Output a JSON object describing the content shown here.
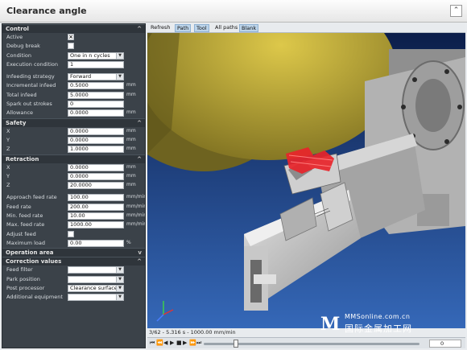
{
  "window": {
    "title": "Clearance angle",
    "collapse_icon": "chevron-up-icon"
  },
  "panel": {
    "control": {
      "header": "Control",
      "rows": [
        {
          "label": "Active",
          "type": "checkbox",
          "checked": true
        },
        {
          "label": "Debug break",
          "type": "checkbox",
          "checked": false
        },
        {
          "label": "Condition",
          "type": "select",
          "value": "One in n cycles"
        },
        {
          "label": "Execution condition",
          "type": "text",
          "value": "1"
        }
      ],
      "rows2": [
        {
          "label": "Infeeding strategy",
          "type": "select",
          "value": "Forward"
        },
        {
          "label": "Incremental infeed",
          "type": "text",
          "value": "0.5000",
          "unit": "mm"
        },
        {
          "label": "Total infeed",
          "type": "text",
          "value": "5.0000",
          "unit": "mm"
        },
        {
          "label": "Spark out strokes",
          "type": "text",
          "value": "0"
        },
        {
          "label": "Allowance",
          "type": "text",
          "value": "0.0000",
          "unit": "mm"
        }
      ]
    },
    "safety": {
      "header": "Safety",
      "rows": [
        {
          "label": "X",
          "value": "0.0000",
          "unit": "mm"
        },
        {
          "label": "Y",
          "value": "0.0000",
          "unit": "mm"
        },
        {
          "label": "Z",
          "value": "1.0000",
          "unit": "mm"
        }
      ]
    },
    "retraction": {
      "header": "Retraction",
      "rows": [
        {
          "label": "X",
          "value": "0.0000",
          "unit": "mm"
        },
        {
          "label": "Y",
          "value": "0.0000",
          "unit": "mm"
        },
        {
          "label": "Z",
          "value": "20.0000",
          "unit": "mm"
        }
      ],
      "rows2": [
        {
          "label": "Approach feed rate",
          "type": "text",
          "value": "100.00",
          "unit": "mm/min"
        },
        {
          "label": "Feed rate",
          "type": "text",
          "value": "200.00",
          "unit": "mm/min"
        },
        {
          "label": "Min. feed rate",
          "type": "text",
          "value": "10.00",
          "unit": "mm/min"
        },
        {
          "label": "Max. feed rate",
          "type": "text",
          "value": "1000.00",
          "unit": "mm/min"
        },
        {
          "label": "Adjust feed",
          "type": "checkbox",
          "checked": false
        },
        {
          "label": "Maximum load",
          "type": "text",
          "value": "0.00",
          "unit": "%"
        }
      ]
    },
    "operation_area": {
      "header": "Operation area"
    },
    "correction": {
      "header": "Correction values",
      "rows": [
        {
          "label": "Feed filter",
          "value": ""
        },
        {
          "label": "Park position",
          "value": ""
        },
        {
          "label": "Post processor",
          "value": "Clearance surfaces"
        },
        {
          "label": "Additional equipment",
          "value": ""
        }
      ]
    },
    "expand_chevron": "^",
    "collapse_chevron": "v"
  },
  "viewer": {
    "toolbar": [
      {
        "label": "Refresh",
        "active": false
      },
      {
        "label": "Path",
        "active": true
      },
      {
        "label": "Tool",
        "active": true
      },
      {
        "label": "All paths",
        "active": false
      },
      {
        "label": "Blank",
        "active": true
      }
    ],
    "status": "3/62 - 5.316 s - 1000.00 mm/min",
    "playback": {
      "buttons": [
        "skip-start-icon",
        "rewind-icon",
        "step-back-icon",
        "play-icon",
        "stop-icon",
        "step-forward-icon",
        "fast-forward-icon",
        "skip-end-icon"
      ],
      "position": 0.15,
      "zoom": "0"
    },
    "colors": {
      "background": "#1c3d7a",
      "wheel": "#b9a63b",
      "workpiece": "#c9c9c9",
      "path": "#e8242a"
    }
  },
  "watermark": {
    "logo": "M",
    "top": "MMSonline.com.cn",
    "bottom": "国际金属加工网"
  }
}
